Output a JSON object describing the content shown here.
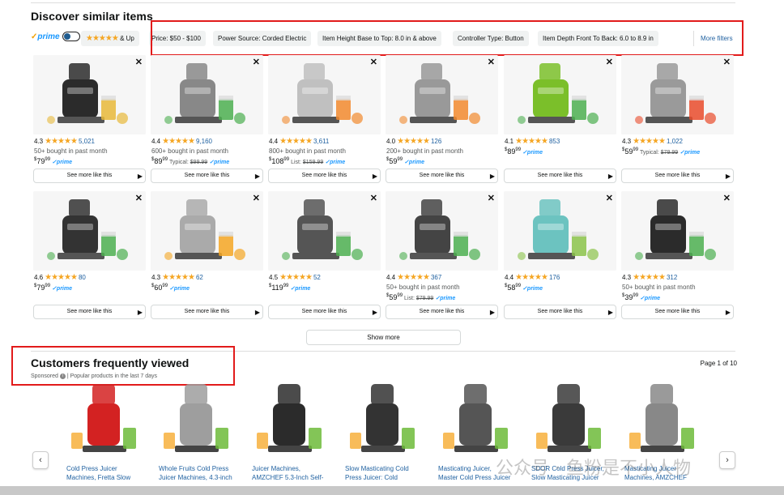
{
  "section": {
    "title": "Discover similar items"
  },
  "filters": {
    "prime_label": "prime",
    "stars_chip": "& Up",
    "chips": [
      "Price: $50 - $100",
      "Power Source: Corded Electric",
      "Item Height Base to Top: 8.0 in & above",
      "Controller Type: Button",
      "Item Depth Front To Back: 6.0 to 8.9 in"
    ],
    "more_filters": "More filters"
  },
  "products": [
    {
      "rating": "4.3",
      "count": "5,021",
      "bought": "50+ bought in past month",
      "price": "79",
      "cents": "99",
      "tag": "",
      "was": "",
      "prime": "prime",
      "see_more": "See more like this",
      "color": "#2b2b2b",
      "accent": "#e8b93a"
    },
    {
      "rating": "4.4",
      "count": "9,160",
      "bought": "600+ bought in past month",
      "price": "89",
      "cents": "99",
      "tag": "Typical:",
      "was": "$99.99",
      "prime": "prime",
      "see_more": "See more like this",
      "color": "#888",
      "accent": "#4caf50"
    },
    {
      "rating": "4.4",
      "count": "3,611",
      "bought": "800+ bought in past month",
      "price": "108",
      "cents": "99",
      "tag": "List:",
      "was": "$159.99",
      "prime": "prime",
      "see_more": "See more like this",
      "color": "#c0c0c0",
      "accent": "#f28a2e"
    },
    {
      "rating": "4.0",
      "count": "126",
      "bought": "200+ bought in past month",
      "price": "59",
      "cents": "99",
      "tag": "",
      "was": "",
      "prime": "prime",
      "see_more": "See more like this",
      "color": "#999",
      "accent": "#f28a2e"
    },
    {
      "rating": "4.1",
      "count": "853",
      "bought": "",
      "price": "89",
      "cents": "99",
      "tag": "",
      "was": "",
      "prime": "prime",
      "see_more": "See more like this",
      "color": "#7bbf2a",
      "accent": "#4caf50"
    },
    {
      "rating": "4.3",
      "count": "1,022",
      "bought": "",
      "price": "59",
      "cents": "99",
      "tag": "Typical:",
      "was": "$79.99",
      "prime": "prime",
      "see_more": "See more like this",
      "color": "#9a9a9a",
      "accent": "#e94b2b"
    },
    {
      "rating": "4.6",
      "count": "80",
      "bought": "",
      "price": "79",
      "cents": "99",
      "tag": "",
      "was": "",
      "prime": "prime",
      "see_more": "See more like this",
      "color": "#333",
      "accent": "#4caf50"
    },
    {
      "rating": "4.3",
      "count": "62",
      "bought": "",
      "price": "60",
      "cents": "99",
      "tag": "",
      "was": "",
      "prime": "prime",
      "see_more": "See more like this",
      "color": "#aaa",
      "accent": "#f5a623"
    },
    {
      "rating": "4.5",
      "count": "52",
      "bought": "",
      "price": "119",
      "cents": "99",
      "tag": "",
      "was": "",
      "prime": "prime",
      "see_more": "See more like this",
      "color": "#555",
      "accent": "#4caf50"
    },
    {
      "rating": "4.4",
      "count": "367",
      "bought": "50+ bought in past month",
      "price": "59",
      "cents": "99",
      "tag": "List:",
      "was": "$79.99",
      "prime": "prime",
      "see_more": "See more like this",
      "color": "#444",
      "accent": "#4caf50"
    },
    {
      "rating": "4.4",
      "count": "176",
      "bought": "",
      "price": "58",
      "cents": "99",
      "tag": "",
      "was": "",
      "prime": "prime",
      "see_more": "See more like this",
      "color": "#6cc3c0",
      "accent": "#8bc34a"
    },
    {
      "rating": "4.3",
      "count": "312",
      "bought": "50+ bought in past month",
      "price": "39",
      "cents": "99",
      "tag": "",
      "was": "",
      "prime": "prime",
      "see_more": "See more like this",
      "color": "#2b2b2b",
      "accent": "#4caf50"
    }
  ],
  "show_more": "Show more",
  "frequently_viewed": {
    "title": "Customers frequently viewed",
    "sponsored": "Sponsored",
    "subtitle": "| Popular products in the last 7 days",
    "page": "Page 1 of 10",
    "prev": "‹",
    "next": "›",
    "items": [
      {
        "name": "Cold Press Juicer",
        "name2": "Machines, Fretta Slow",
        "color": "#d32222"
      },
      {
        "name": "Whole Fruits Cold Press",
        "name2": "Juicer Machines, 4.3-inch",
        "color": "#9e9e9e"
      },
      {
        "name": "Juicer Machines,",
        "name2": "AMZCHEF 5.3-Inch Self-",
        "color": "#2b2b2b"
      },
      {
        "name": "Slow Masticating Cold",
        "name2": "Press Juicer: Cold",
        "color": "#333"
      },
      {
        "name": "Masticating Juicer,",
        "name2": "Master Cold Press Juicer",
        "color": "#555"
      },
      {
        "name": "SDOR Cold Press Juicer,",
        "name2": "Slow Masticating Juicer",
        "color": "#3a3a3a"
      },
      {
        "name": "Masticating Juicer",
        "name2": "Machines, AMZCHEF",
        "color": "#888"
      }
    ]
  },
  "watermark": "公众号 · 鱼粉是不小人物"
}
